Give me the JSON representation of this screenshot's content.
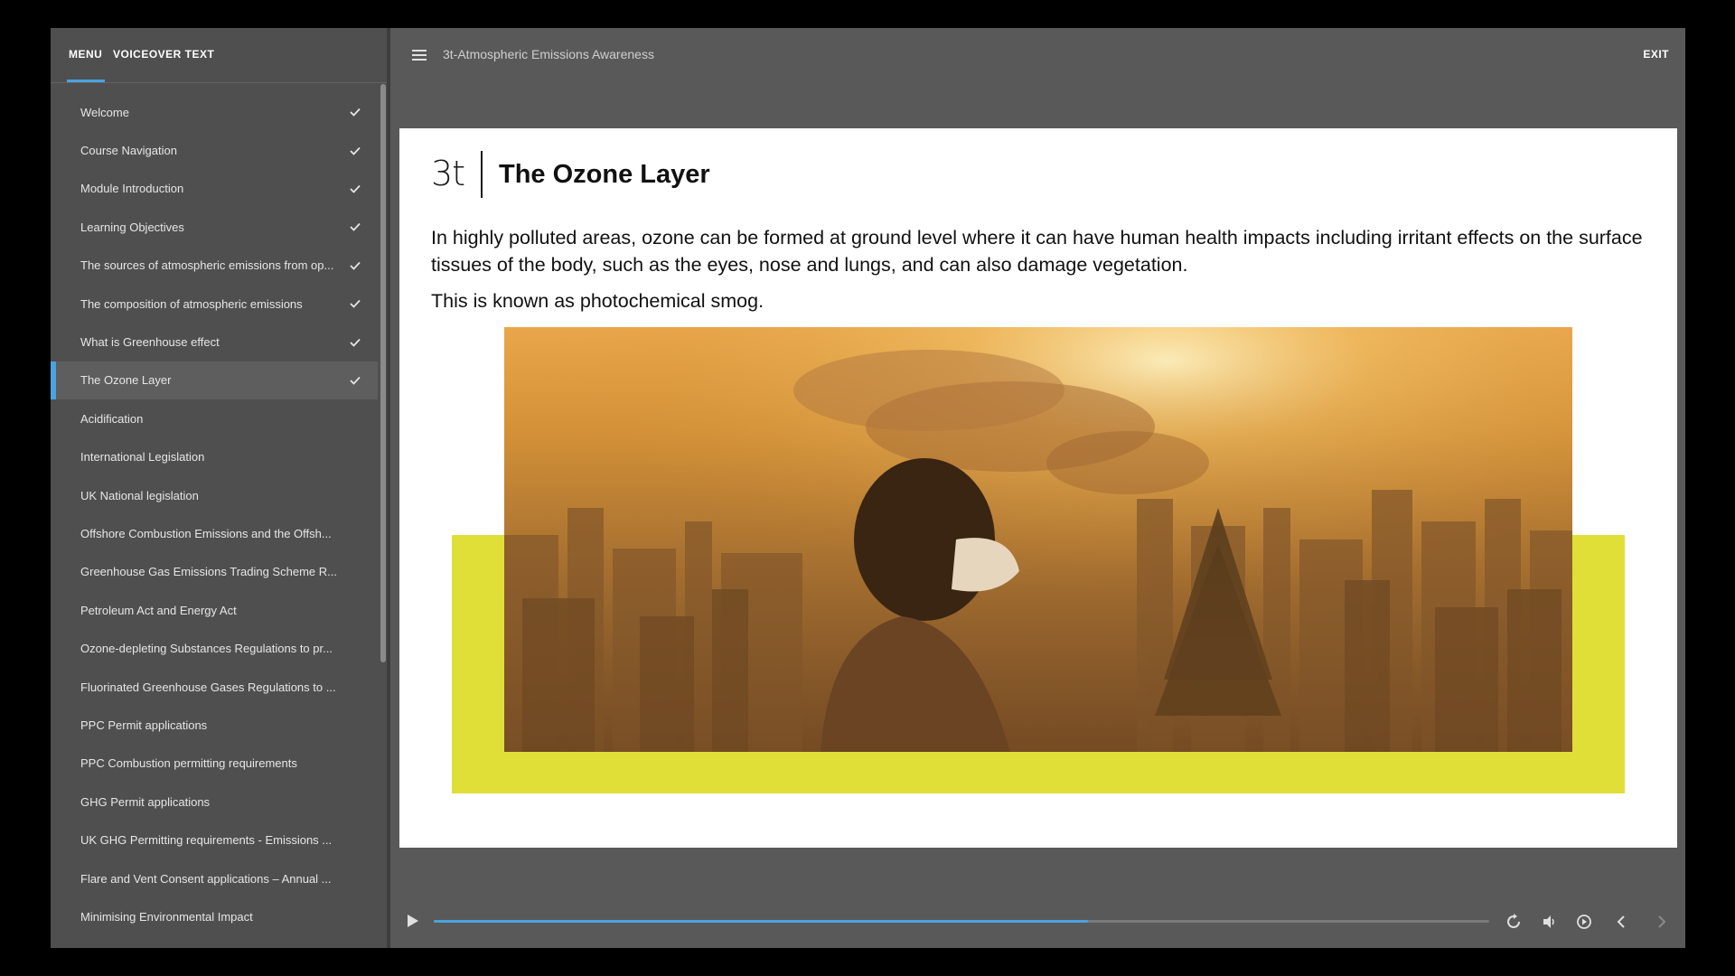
{
  "sidebar": {
    "tabs": {
      "menu": "MENU",
      "voiceover": "VOICEOVER TEXT"
    },
    "items": [
      {
        "label": "Welcome",
        "done": true,
        "active": false
      },
      {
        "label": "Course Navigation",
        "done": true,
        "active": false
      },
      {
        "label": "Module Introduction",
        "done": true,
        "active": false
      },
      {
        "label": "Learning Objectives",
        "done": true,
        "active": false
      },
      {
        "label": "The sources of atmospheric emissions from op...",
        "done": true,
        "active": false
      },
      {
        "label": "The composition of atmospheric emissions",
        "done": true,
        "active": false
      },
      {
        "label": "What is Greenhouse effect",
        "done": true,
        "active": false
      },
      {
        "label": "The Ozone Layer",
        "done": true,
        "active": true
      },
      {
        "label": "Acidification",
        "done": false,
        "active": false
      },
      {
        "label": "International Legislation",
        "done": false,
        "active": false
      },
      {
        "label": "UK National legislation",
        "done": false,
        "active": false
      },
      {
        "label": "Offshore Combustion Emissions and the Offsh...",
        "done": false,
        "active": false
      },
      {
        "label": "Greenhouse Gas Emissions Trading Scheme R...",
        "done": false,
        "active": false
      },
      {
        "label": "Petroleum Act and Energy Act",
        "done": false,
        "active": false
      },
      {
        "label": "Ozone-depleting Substances Regulations to pr...",
        "done": false,
        "active": false
      },
      {
        "label": "Fluorinated Greenhouse Gases Regulations to ...",
        "done": false,
        "active": false
      },
      {
        "label": "PPC Permit applications",
        "done": false,
        "active": false
      },
      {
        "label": "PPC Combustion permitting requirements",
        "done": false,
        "active": false
      },
      {
        "label": "GHG Permit applications",
        "done": false,
        "active": false
      },
      {
        "label": "UK GHG Permitting requirements - Emissions ...",
        "done": false,
        "active": false
      },
      {
        "label": "Flare and Vent Consent applications – Annual ...",
        "done": false,
        "active": false
      },
      {
        "label": "Minimising Environmental Impact",
        "done": false,
        "active": false
      }
    ]
  },
  "topbar": {
    "course_title": "3t-Atmospheric Emissions Awareness",
    "exit_label": "EXIT"
  },
  "slide": {
    "logo": "3t",
    "title": "The Ozone Layer",
    "paragraph1": "In highly polluted areas, ozone can be formed at ground level where it can have human health impacts including irritant effects on the surface tissues of the body, such as the eyes, nose and lungs, and can also damage vegetation.",
    "paragraph2": "This is known as photochemical smog.",
    "accent_color": "#e0df38"
  },
  "player": {
    "progress": 0.62,
    "accent_color": "#4aa3df"
  }
}
